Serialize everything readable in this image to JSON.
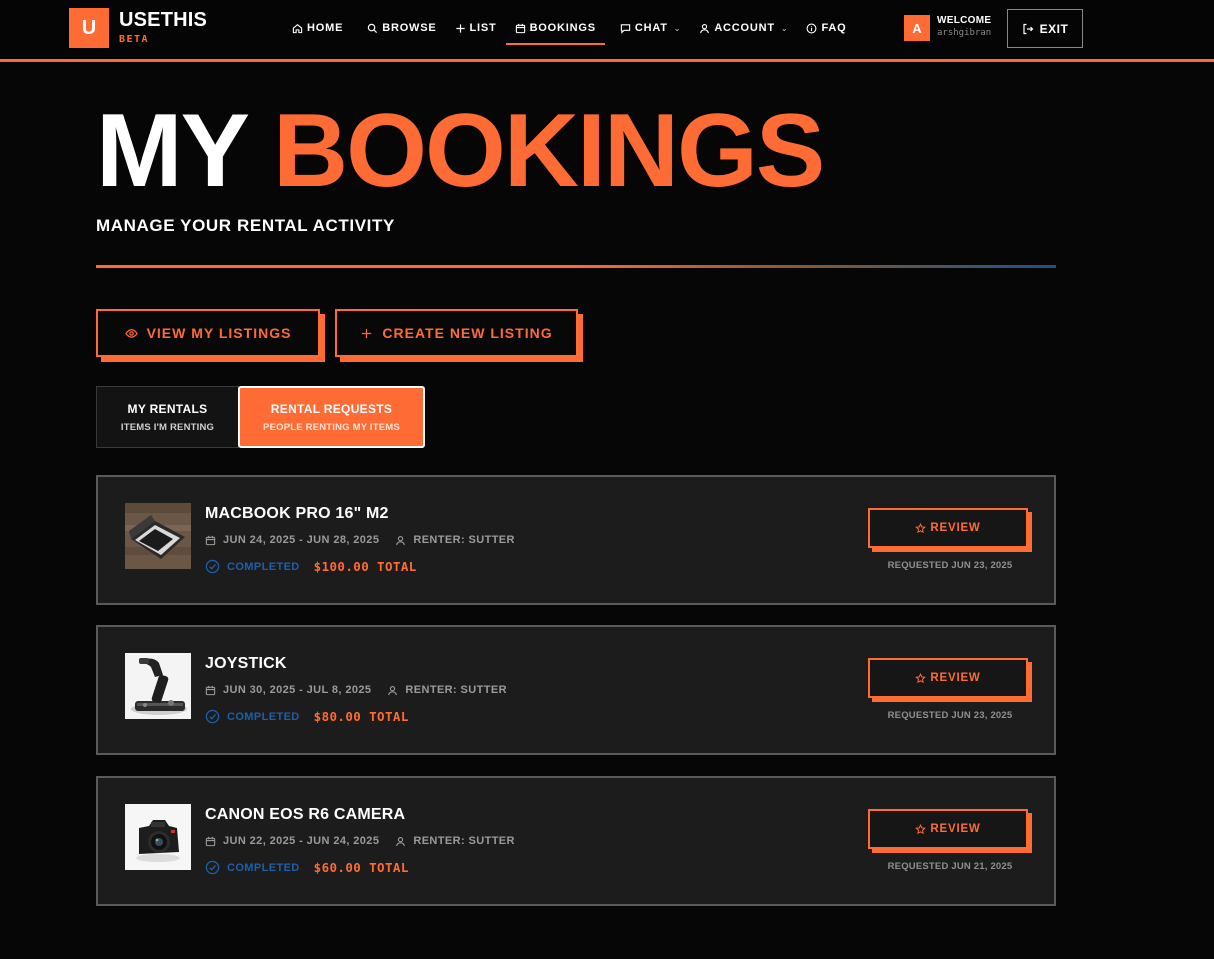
{
  "header": {
    "logo_letter": "U",
    "brand_name": "USETHIS",
    "brand_tag": "BETA",
    "nav": [
      {
        "label": "HOME",
        "icon": "home-icon"
      },
      {
        "label": "BROWSE",
        "icon": "search-icon"
      },
      {
        "label": "LIST",
        "icon": "plus-icon"
      },
      {
        "label": "BOOKINGS",
        "icon": "calendar-icon",
        "active": true
      },
      {
        "label": "CHAT",
        "icon": "chat-icon",
        "dropdown": true
      },
      {
        "label": "ACCOUNT",
        "icon": "user-icon",
        "dropdown": true
      },
      {
        "label": "FAQ",
        "icon": "info-icon"
      }
    ],
    "avatar_letter": "A",
    "welcome_label": "WELCOME",
    "username": "arshgibran",
    "exit_label": "EXIT"
  },
  "hero": {
    "title_part1": "MY",
    "title_part2": "BOOKINGS",
    "subtitle": "MANAGE YOUR RENTAL ACTIVITY"
  },
  "actions": {
    "view_listings": "VIEW MY LISTINGS",
    "create_listing": "CREATE NEW LISTING"
  },
  "tabs": [
    {
      "title": "MY RENTALS",
      "subtitle": "ITEMS I'M RENTING",
      "active": false
    },
    {
      "title": "RENTAL REQUESTS",
      "subtitle": "PEOPLE RENTING MY ITEMS",
      "active": true
    }
  ],
  "bookings": [
    {
      "title": "MACBOOK PRO 16\" M2",
      "dates": "JUN 24, 2025 - JUN 28, 2025",
      "renter": "RENTER: SUTTER",
      "status": "COMPLETED",
      "total": "$100.00 TOTAL",
      "action": "REVIEW",
      "requested": "REQUESTED JUN 23, 2025",
      "image": "laptop-image"
    },
    {
      "title": "JOYSTICK",
      "dates": "JUN 30, 2025 - JUL 8, 2025",
      "renter": "RENTER: SUTTER",
      "status": "COMPLETED",
      "total": "$80.00 TOTAL",
      "action": "REVIEW",
      "requested": "REQUESTED JUN 23, 2025",
      "image": "joystick-image"
    },
    {
      "title": "CANON EOS R6 CAMERA",
      "dates": "JUN 22, 2025 - JUN 24, 2025",
      "renter": "RENTER: SUTTER",
      "status": "COMPLETED",
      "total": "$60.00 TOTAL",
      "action": "REVIEW",
      "requested": "REQUESTED JUN 21, 2025",
      "image": "camera-image"
    }
  ],
  "colors": {
    "accent": "#ff6b35",
    "status_completed": "#1d5fa8",
    "background": "#060606",
    "card": "#1c1c1c"
  }
}
